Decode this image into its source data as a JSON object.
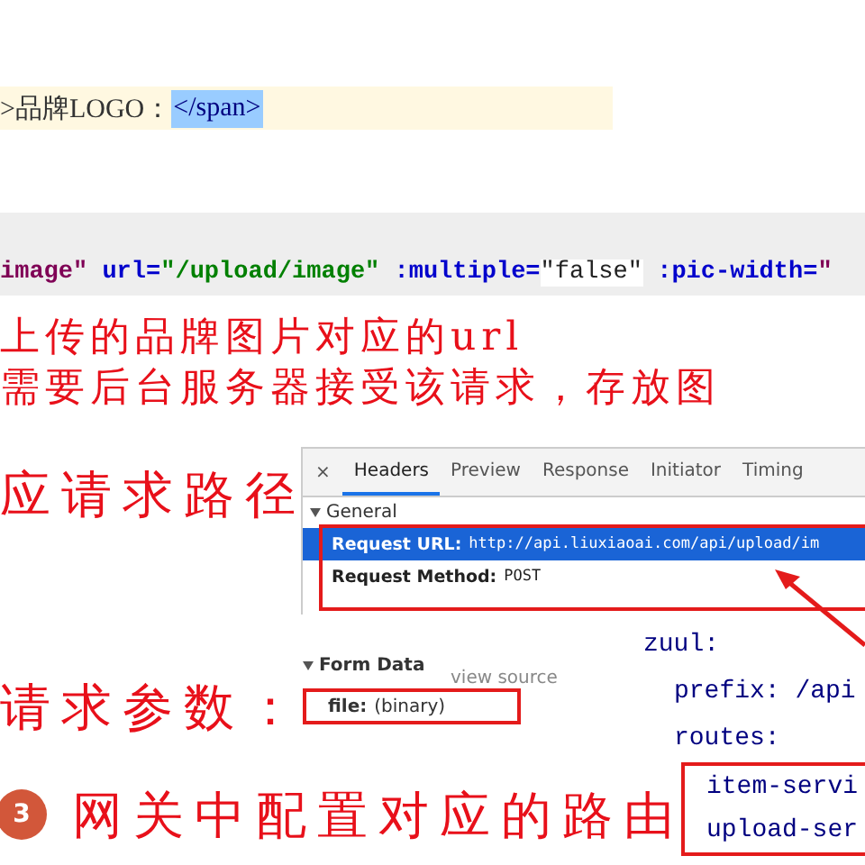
{
  "html_snippet": {
    "text": ">品牌LOGO：",
    "selected_tag": "</span>"
  },
  "code_line": [
    {
      "kind": "attr",
      "text": "image\""
    },
    {
      "kind": "key",
      "text": " url="
    },
    {
      "kind": "str",
      "text": "\"/upload/image\""
    },
    {
      "kind": "key",
      "text": " :multiple="
    },
    {
      "kind": "plain",
      "text": "\"false\""
    },
    {
      "kind": "key",
      "text": " :pic-width="
    },
    {
      "kind": "attr",
      "text": "\""
    }
  ],
  "notes": [
    "上传的品牌图片对应的url",
    "需要后台服务器接受该请求，存放图"
  ],
  "label_path": "应请求路径",
  "label_params": "请求参数：",
  "devtools": {
    "close": "×",
    "tabs": [
      {
        "label": "Headers",
        "selected": true
      },
      {
        "label": "Preview",
        "selected": false
      },
      {
        "label": "Response",
        "selected": false
      },
      {
        "label": "Initiator",
        "selected": false
      },
      {
        "label": "Timing",
        "selected": false
      }
    ],
    "section": "General",
    "rows": [
      {
        "name": "Request URL:",
        "value": "http://api.liuxiaoai.com/api/upload/im",
        "selected": true
      },
      {
        "name": "Request Method:",
        "value": "POST",
        "selected": false
      }
    ]
  },
  "form_data": {
    "title": "Form Data",
    "link": "view source",
    "field": "file:",
    "value": "(binary)"
  },
  "yaml": [
    "zuul:",
    "prefix: /api",
    "routes:"
  ],
  "yaml_boxed": [
    "item-servi",
    "upload-ser"
  ],
  "step": {
    "number": "3",
    "text": "网关中配置对应的路由"
  }
}
